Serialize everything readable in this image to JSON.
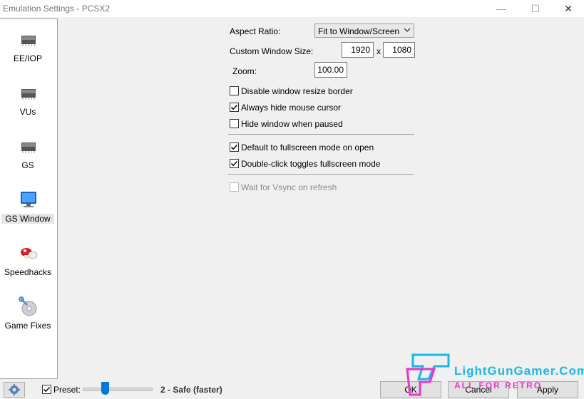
{
  "window": {
    "title": "Emulation Settings - PCSX2",
    "minimize": "—",
    "maximize": "☐",
    "close": "✕"
  },
  "sidebar": {
    "items": [
      {
        "label": "EE/IOP",
        "icon": "chip-icon"
      },
      {
        "label": "VUs",
        "icon": "chip-icon"
      },
      {
        "label": "GS",
        "icon": "chip-icon"
      },
      {
        "label": "GS Window",
        "icon": "monitor-icon",
        "selected": true
      },
      {
        "label": "Speedhacks",
        "icon": "mushroom-icon"
      },
      {
        "label": "Game Fixes",
        "icon": "disc-wrench-icon"
      }
    ]
  },
  "settings": {
    "aspect_ratio_label": "Aspect Ratio:",
    "aspect_ratio_value": "Fit to Window/Screen",
    "custom_size_label": "Custom Window Size:",
    "width": "1920",
    "x_sep": "x",
    "height": "1080",
    "zoom_label": "Zoom:",
    "zoom": "100.00",
    "checkboxes": [
      {
        "label": "Disable window resize border",
        "checked": false
      },
      {
        "label": "Always hide mouse cursor",
        "checked": true
      },
      {
        "label": "Hide window when paused",
        "checked": false
      },
      {
        "label": "Default to fullscreen mode on open",
        "checked": true
      },
      {
        "label": "Double-click toggles fullscreen mode",
        "checked": true
      },
      {
        "label": "Wait for Vsync on refresh",
        "checked": false,
        "disabled": true
      }
    ]
  },
  "footer": {
    "preset_label": "Preset:",
    "preset_checked": true,
    "preset_value": "2 - Safe (faster)",
    "preset_level": 2,
    "ok": "OK",
    "cancel": "Cancel",
    "apply": "Apply",
    "watermark_line1": "LightGunGamer.Com",
    "watermark_line2": "ALL FOR RETRO"
  },
  "colors": {
    "accent": "#007ad9",
    "watermark_pink": "#e838c8",
    "watermark_cyan": "#19b8e6"
  }
}
